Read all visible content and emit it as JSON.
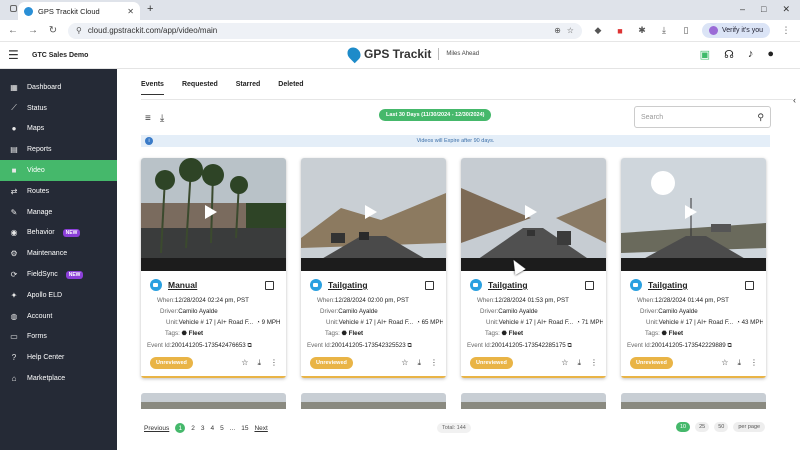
{
  "browser": {
    "tab_title": "GPS Trackit Cloud",
    "new_tab": "+",
    "url": "cloud.gpstrackit.com/app/video/main",
    "verify_label": "Verify it's you",
    "window_controls": [
      "–",
      "□",
      "✕"
    ]
  },
  "header": {
    "org": "GTC Sales Demo",
    "logo_text": "GPS Trackit",
    "tagline": "Miles Ahead"
  },
  "sidebar": {
    "items": [
      {
        "label": "Dashboard",
        "icon": "dashboard-icon",
        "glyph": "▦",
        "new": ""
      },
      {
        "label": "Status",
        "icon": "status-icon",
        "glyph": "⟋",
        "new": ""
      },
      {
        "label": "Maps",
        "icon": "map-pin-icon",
        "glyph": "●",
        "new": ""
      },
      {
        "label": "Reports",
        "icon": "reports-icon",
        "glyph": "▤",
        "new": ""
      },
      {
        "label": "Video",
        "icon": "video-icon",
        "glyph": "■",
        "new": ""
      },
      {
        "label": "Routes",
        "icon": "routes-icon",
        "glyph": "⇄",
        "new": ""
      },
      {
        "label": "Manage",
        "icon": "wrench-icon",
        "glyph": "✎",
        "new": ""
      },
      {
        "label": "Behavior",
        "icon": "behavior-icon",
        "glyph": "◉",
        "new": "NEW"
      },
      {
        "label": "Maintenance",
        "icon": "maintenance-icon",
        "glyph": "⚙",
        "new": ""
      },
      {
        "label": "FieldSync",
        "icon": "fieldsync-icon",
        "glyph": "⟳",
        "new": "NEW"
      },
      {
        "label": "Apollo ELD",
        "icon": "eld-icon",
        "glyph": "✦",
        "new": ""
      },
      {
        "label": "Account",
        "icon": "account-icon",
        "glyph": "◍",
        "new": ""
      },
      {
        "label": "Forms",
        "icon": "forms-icon",
        "glyph": "▭",
        "new": ""
      },
      {
        "label": "Help Center",
        "icon": "help-icon",
        "glyph": "?",
        "new": ""
      },
      {
        "label": "Marketplace",
        "icon": "marketplace-icon",
        "glyph": "⌂",
        "new": ""
      }
    ],
    "active": "Video"
  },
  "tabs": {
    "items": [
      "Events",
      "Requested",
      "Starred",
      "Deleted"
    ],
    "active": "Events"
  },
  "toolbar": {
    "date_range": "Last 30 Days (11/30/2024 - 12/30/2024)",
    "search_placeholder": "Search"
  },
  "info": {
    "text": "Videos will Expire after 90 days."
  },
  "cards": [
    {
      "event": "Manual",
      "when": "12/28/2024 02:24 pm, PST",
      "driver": "Camilo Ayalde",
      "unit": "Vehicle # 17 | AI+ Road F...",
      "speed": "9 MPH",
      "tag": "Fleet",
      "event_id": "200141205-173542476653",
      "status": "Unreviewed"
    },
    {
      "event": "Tailgating",
      "when": "12/28/2024 02:00 pm, PST",
      "driver": "Camilo Ayalde",
      "unit": "Vehicle # 17 | AI+ Road F...",
      "speed": "65 MPH",
      "tag": "Fleet",
      "event_id": "200141205-173542325523",
      "status": "Unreviewed"
    },
    {
      "event": "Tailgating",
      "when": "12/28/2024 01:53 pm, PST",
      "driver": "Camilo Ayalde",
      "unit": "Vehicle # 17 | AI+ Road F...",
      "speed": "71 MPH",
      "tag": "Fleet",
      "event_id": "200141205-173542285175",
      "status": "Unreviewed"
    },
    {
      "event": "Tailgating",
      "when": "12/28/2024 01:44 pm, PST",
      "driver": "Camilo Ayalde",
      "unit": "Vehicle # 17 | AI+ Road F...",
      "speed": "43 MPH",
      "tag": "Fleet",
      "event_id": "200141205-173542229889",
      "status": "Unreviewed"
    }
  ],
  "labels": {
    "when": "When:",
    "driver": "Driver:",
    "unit": "Unit:",
    "tags": "Tags:",
    "event_id": "Event Id:"
  },
  "pagination": {
    "previous": "Previous",
    "pages": [
      "1",
      "2",
      "3",
      "4",
      "5",
      "...",
      "15"
    ],
    "current": "1",
    "next": "Next",
    "total": "Total: 144",
    "per_page_options": [
      "10",
      "25",
      "50"
    ],
    "per_page_selected": "10",
    "per_page_label": "per page"
  },
  "colors": {
    "accent": "#45b86b",
    "sidebar": "#252a36",
    "status": "#e9b446",
    "new_badge": "#8b3fd8",
    "info": "#3a6ea8"
  }
}
